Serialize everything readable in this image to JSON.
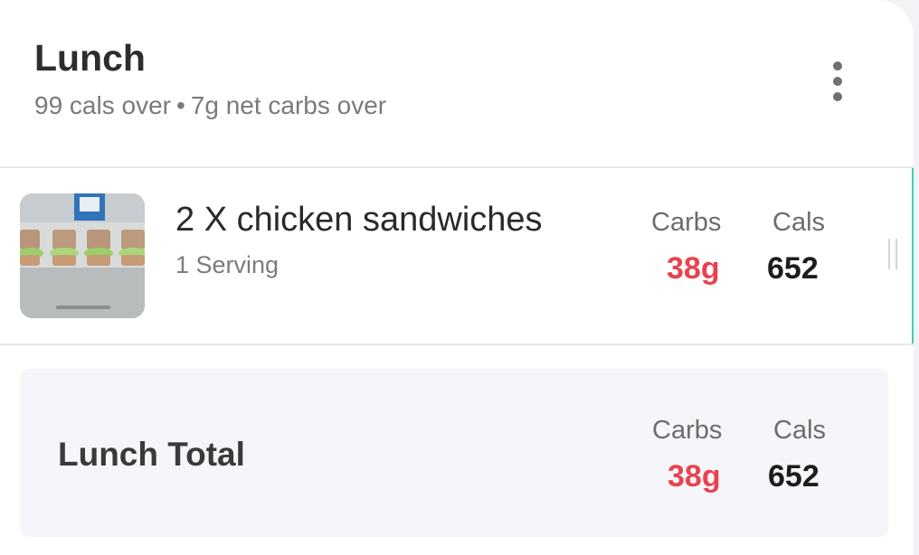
{
  "meal": {
    "title": "Lunch",
    "calories_over": "99 cals over",
    "separator": "•",
    "carbs_over": "7g net carbs over",
    "menu_icon": "more-vertical-icon"
  },
  "food_items": [
    {
      "name": "2 X chicken sandwiches",
      "serving": "1 Serving",
      "carbs_label": "Carbs",
      "carbs_value": "38g",
      "cals_label": "Cals",
      "cals_value": "652",
      "image": "sandwiches-photo"
    }
  ],
  "total": {
    "title": "Lunch Total",
    "carbs_label": "Carbs",
    "carbs_value": "38g",
    "cals_label": "Cals",
    "cals_value": "652"
  },
  "colors": {
    "carbs_over": "#e8424f",
    "accent": "#3fd2b0"
  }
}
